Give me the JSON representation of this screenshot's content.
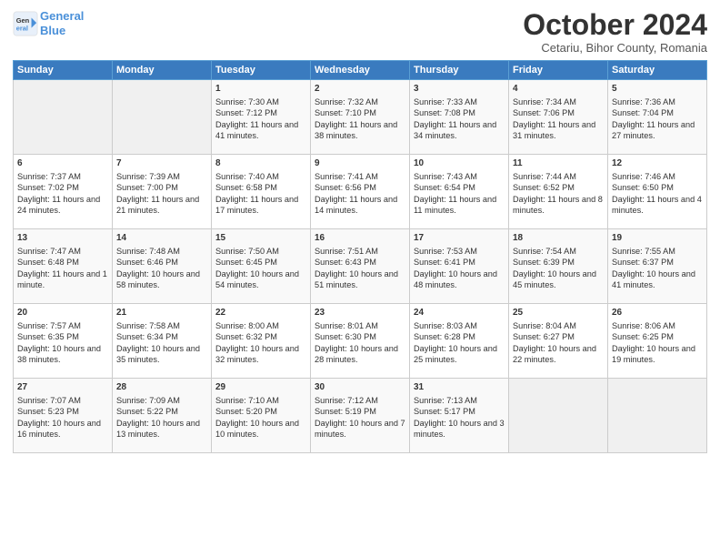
{
  "header": {
    "logo_line1": "General",
    "logo_line2": "Blue",
    "month": "October 2024",
    "location": "Cetariu, Bihor County, Romania"
  },
  "weekdays": [
    "Sunday",
    "Monday",
    "Tuesday",
    "Wednesday",
    "Thursday",
    "Friday",
    "Saturday"
  ],
  "weeks": [
    [
      {
        "day": "",
        "info": ""
      },
      {
        "day": "",
        "info": ""
      },
      {
        "day": "1",
        "info": "Sunrise: 7:30 AM\nSunset: 7:12 PM\nDaylight: 11 hours and 41 minutes."
      },
      {
        "day": "2",
        "info": "Sunrise: 7:32 AM\nSunset: 7:10 PM\nDaylight: 11 hours and 38 minutes."
      },
      {
        "day": "3",
        "info": "Sunrise: 7:33 AM\nSunset: 7:08 PM\nDaylight: 11 hours and 34 minutes."
      },
      {
        "day": "4",
        "info": "Sunrise: 7:34 AM\nSunset: 7:06 PM\nDaylight: 11 hours and 31 minutes."
      },
      {
        "day": "5",
        "info": "Sunrise: 7:36 AM\nSunset: 7:04 PM\nDaylight: 11 hours and 27 minutes."
      }
    ],
    [
      {
        "day": "6",
        "info": "Sunrise: 7:37 AM\nSunset: 7:02 PM\nDaylight: 11 hours and 24 minutes."
      },
      {
        "day": "7",
        "info": "Sunrise: 7:39 AM\nSunset: 7:00 PM\nDaylight: 11 hours and 21 minutes."
      },
      {
        "day": "8",
        "info": "Sunrise: 7:40 AM\nSunset: 6:58 PM\nDaylight: 11 hours and 17 minutes."
      },
      {
        "day": "9",
        "info": "Sunrise: 7:41 AM\nSunset: 6:56 PM\nDaylight: 11 hours and 14 minutes."
      },
      {
        "day": "10",
        "info": "Sunrise: 7:43 AM\nSunset: 6:54 PM\nDaylight: 11 hours and 11 minutes."
      },
      {
        "day": "11",
        "info": "Sunrise: 7:44 AM\nSunset: 6:52 PM\nDaylight: 11 hours and 8 minutes."
      },
      {
        "day": "12",
        "info": "Sunrise: 7:46 AM\nSunset: 6:50 PM\nDaylight: 11 hours and 4 minutes."
      }
    ],
    [
      {
        "day": "13",
        "info": "Sunrise: 7:47 AM\nSunset: 6:48 PM\nDaylight: 11 hours and 1 minute."
      },
      {
        "day": "14",
        "info": "Sunrise: 7:48 AM\nSunset: 6:46 PM\nDaylight: 10 hours and 58 minutes."
      },
      {
        "day": "15",
        "info": "Sunrise: 7:50 AM\nSunset: 6:45 PM\nDaylight: 10 hours and 54 minutes."
      },
      {
        "day": "16",
        "info": "Sunrise: 7:51 AM\nSunset: 6:43 PM\nDaylight: 10 hours and 51 minutes."
      },
      {
        "day": "17",
        "info": "Sunrise: 7:53 AM\nSunset: 6:41 PM\nDaylight: 10 hours and 48 minutes."
      },
      {
        "day": "18",
        "info": "Sunrise: 7:54 AM\nSunset: 6:39 PM\nDaylight: 10 hours and 45 minutes."
      },
      {
        "day": "19",
        "info": "Sunrise: 7:55 AM\nSunset: 6:37 PM\nDaylight: 10 hours and 41 minutes."
      }
    ],
    [
      {
        "day": "20",
        "info": "Sunrise: 7:57 AM\nSunset: 6:35 PM\nDaylight: 10 hours and 38 minutes."
      },
      {
        "day": "21",
        "info": "Sunrise: 7:58 AM\nSunset: 6:34 PM\nDaylight: 10 hours and 35 minutes."
      },
      {
        "day": "22",
        "info": "Sunrise: 8:00 AM\nSunset: 6:32 PM\nDaylight: 10 hours and 32 minutes."
      },
      {
        "day": "23",
        "info": "Sunrise: 8:01 AM\nSunset: 6:30 PM\nDaylight: 10 hours and 28 minutes."
      },
      {
        "day": "24",
        "info": "Sunrise: 8:03 AM\nSunset: 6:28 PM\nDaylight: 10 hours and 25 minutes."
      },
      {
        "day": "25",
        "info": "Sunrise: 8:04 AM\nSunset: 6:27 PM\nDaylight: 10 hours and 22 minutes."
      },
      {
        "day": "26",
        "info": "Sunrise: 8:06 AM\nSunset: 6:25 PM\nDaylight: 10 hours and 19 minutes."
      }
    ],
    [
      {
        "day": "27",
        "info": "Sunrise: 7:07 AM\nSunset: 5:23 PM\nDaylight: 10 hours and 16 minutes."
      },
      {
        "day": "28",
        "info": "Sunrise: 7:09 AM\nSunset: 5:22 PM\nDaylight: 10 hours and 13 minutes."
      },
      {
        "day": "29",
        "info": "Sunrise: 7:10 AM\nSunset: 5:20 PM\nDaylight: 10 hours and 10 minutes."
      },
      {
        "day": "30",
        "info": "Sunrise: 7:12 AM\nSunset: 5:19 PM\nDaylight: 10 hours and 7 minutes."
      },
      {
        "day": "31",
        "info": "Sunrise: 7:13 AM\nSunset: 5:17 PM\nDaylight: 10 hours and 3 minutes."
      },
      {
        "day": "",
        "info": ""
      },
      {
        "day": "",
        "info": ""
      }
    ]
  ]
}
